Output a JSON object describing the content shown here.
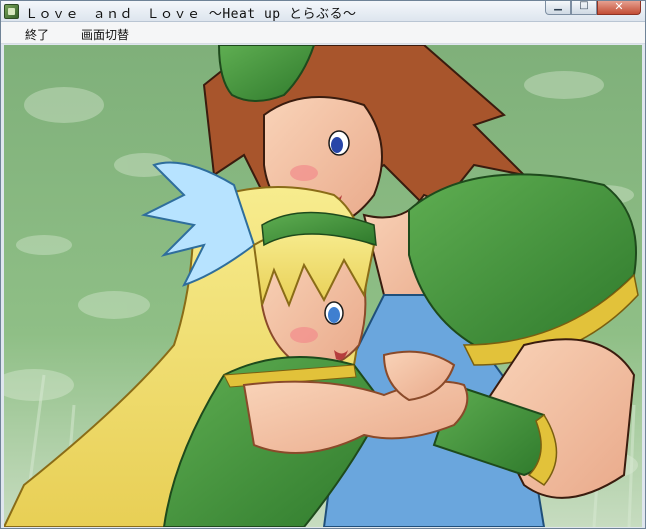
{
  "window": {
    "title": "Ｌｏｖｅ　ａｎｄ　Ｌｏｖｅ 〜Heat up とらぶる〜",
    "icon": "app-icon"
  },
  "menu": {
    "items": [
      {
        "label": "終了"
      },
      {
        "label": "画面切替"
      }
    ]
  },
  "scene": {
    "description_icon": "anime-illustration",
    "background_color": "#8fbf86",
    "accent_green": "#3f8f3a",
    "accent_gold": "#e2c23a",
    "hair_brown": "#a8552c",
    "hair_blonde": "#f2e27a",
    "tunic_blue": "#6aa6dd"
  }
}
